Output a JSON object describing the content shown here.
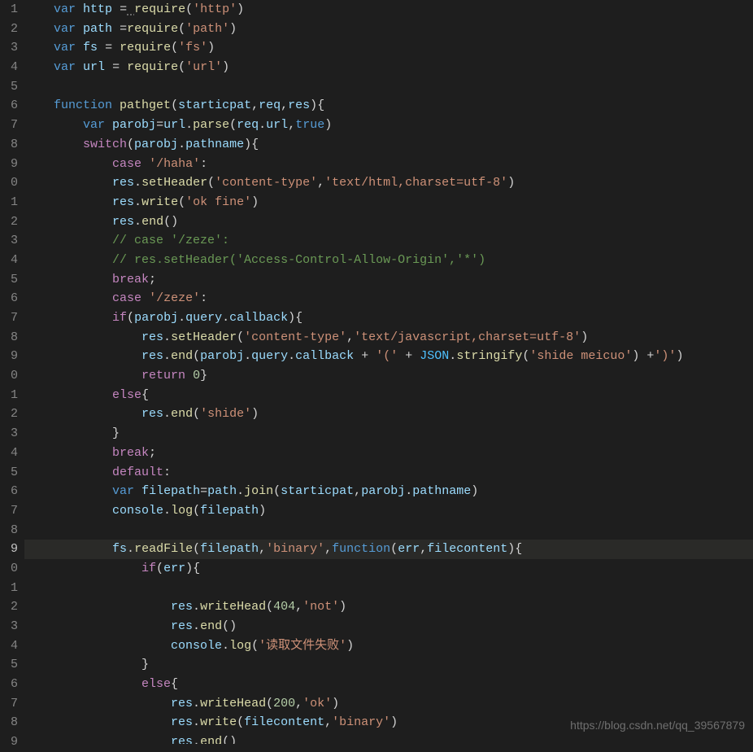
{
  "editor": {
    "highlighted_line_index": 28,
    "gutter": [
      "1",
      "2",
      "3",
      "4",
      "5",
      "6",
      "7",
      "8",
      "9",
      "0",
      "1",
      "2",
      "3",
      "4",
      "5",
      "6",
      "7",
      "8",
      "9",
      "0",
      "1",
      "2",
      "3",
      "4",
      "5",
      "6",
      "7",
      "8",
      "9",
      "0",
      "1",
      "2",
      "3",
      "4",
      "5",
      "6",
      "7",
      "8",
      "9"
    ],
    "lines": [
      {
        "indent": 1,
        "tokens": [
          [
            "keyword",
            "var"
          ],
          [
            "plain",
            " "
          ],
          [
            "var",
            "http"
          ],
          [
            "plain",
            " "
          ],
          [
            "punct",
            "="
          ],
          [
            "plain",
            " "
          ],
          [
            "func",
            "require"
          ],
          [
            "punct",
            "("
          ],
          [
            "string",
            "'http'"
          ],
          [
            "punct",
            ")"
          ]
        ],
        "squiggle": 5
      },
      {
        "indent": 1,
        "tokens": [
          [
            "keyword",
            "var"
          ],
          [
            "plain",
            " "
          ],
          [
            "var",
            "path"
          ],
          [
            "plain",
            " "
          ],
          [
            "punct",
            "="
          ],
          [
            "func",
            "require"
          ],
          [
            "punct",
            "("
          ],
          [
            "string",
            "'path'"
          ],
          [
            "punct",
            ")"
          ]
        ]
      },
      {
        "indent": 1,
        "tokens": [
          [
            "keyword",
            "var"
          ],
          [
            "plain",
            " "
          ],
          [
            "var",
            "fs"
          ],
          [
            "plain",
            " "
          ],
          [
            "punct",
            "="
          ],
          [
            "plain",
            " "
          ],
          [
            "func",
            "require"
          ],
          [
            "punct",
            "("
          ],
          [
            "string",
            "'fs'"
          ],
          [
            "punct",
            ")"
          ]
        ]
      },
      {
        "indent": 1,
        "tokens": [
          [
            "keyword",
            "var"
          ],
          [
            "plain",
            " "
          ],
          [
            "var",
            "url"
          ],
          [
            "plain",
            " "
          ],
          [
            "punct",
            "="
          ],
          [
            "plain",
            " "
          ],
          [
            "func",
            "require"
          ],
          [
            "punct",
            "("
          ],
          [
            "string",
            "'url'"
          ],
          [
            "punct",
            ")"
          ]
        ]
      },
      {
        "indent": 0,
        "tokens": []
      },
      {
        "indent": 1,
        "tokens": [
          [
            "keyword",
            "function"
          ],
          [
            "plain",
            " "
          ],
          [
            "func",
            "pathget"
          ],
          [
            "punct",
            "("
          ],
          [
            "param",
            "starticpat"
          ],
          [
            "punct",
            ","
          ],
          [
            "param",
            "req"
          ],
          [
            "punct",
            ","
          ],
          [
            "param",
            "res"
          ],
          [
            "punct",
            ")"
          ],
          [
            "punct",
            "{"
          ]
        ]
      },
      {
        "indent": 2,
        "tokens": [
          [
            "keyword",
            "var"
          ],
          [
            "plain",
            " "
          ],
          [
            "var",
            "parobj"
          ],
          [
            "punct",
            "="
          ],
          [
            "var",
            "url"
          ],
          [
            "punct",
            "."
          ],
          [
            "func",
            "parse"
          ],
          [
            "punct",
            "("
          ],
          [
            "var",
            "req"
          ],
          [
            "punct",
            "."
          ],
          [
            "var",
            "url"
          ],
          [
            "punct",
            ","
          ],
          [
            "keyword",
            "true"
          ],
          [
            "punct",
            ")"
          ]
        ]
      },
      {
        "indent": 2,
        "tokens": [
          [
            "control",
            "switch"
          ],
          [
            "punct",
            "("
          ],
          [
            "var",
            "parobj"
          ],
          [
            "punct",
            "."
          ],
          [
            "var",
            "pathname"
          ],
          [
            "punct",
            ")"
          ],
          [
            "punct",
            "{"
          ]
        ]
      },
      {
        "indent": 3,
        "tokens": [
          [
            "control",
            "case"
          ],
          [
            "plain",
            " "
          ],
          [
            "string",
            "'/haha'"
          ],
          [
            "punct",
            ":"
          ]
        ]
      },
      {
        "indent": 3,
        "tokens": [
          [
            "var",
            "res"
          ],
          [
            "punct",
            "."
          ],
          [
            "func",
            "setHeader"
          ],
          [
            "punct",
            "("
          ],
          [
            "string",
            "'content-type'"
          ],
          [
            "punct",
            ","
          ],
          [
            "string",
            "'text/html,charset=utf-8'"
          ],
          [
            "punct",
            ")"
          ]
        ]
      },
      {
        "indent": 3,
        "tokens": [
          [
            "var",
            "res"
          ],
          [
            "punct",
            "."
          ],
          [
            "func",
            "write"
          ],
          [
            "punct",
            "("
          ],
          [
            "string",
            "'ok fine'"
          ],
          [
            "punct",
            ")"
          ]
        ]
      },
      {
        "indent": 3,
        "tokens": [
          [
            "var",
            "res"
          ],
          [
            "punct",
            "."
          ],
          [
            "func",
            "end"
          ],
          [
            "punct",
            "()"
          ]
        ]
      },
      {
        "indent": 3,
        "tokens": [
          [
            "comment",
            "// case '/zeze':"
          ]
        ]
      },
      {
        "indent": 3,
        "tokens": [
          [
            "comment",
            "// res.setHeader('Access-Control-Allow-Origin','*')"
          ]
        ]
      },
      {
        "indent": 3,
        "tokens": [
          [
            "control",
            "break"
          ],
          [
            "punct",
            ";"
          ]
        ]
      },
      {
        "indent": 3,
        "tokens": [
          [
            "control",
            "case"
          ],
          [
            "plain",
            " "
          ],
          [
            "string",
            "'/zeze'"
          ],
          [
            "punct",
            ":"
          ]
        ]
      },
      {
        "indent": 3,
        "tokens": [
          [
            "control",
            "if"
          ],
          [
            "punct",
            "("
          ],
          [
            "var",
            "parobj"
          ],
          [
            "punct",
            "."
          ],
          [
            "var",
            "query"
          ],
          [
            "punct",
            "."
          ],
          [
            "var",
            "callback"
          ],
          [
            "punct",
            ")"
          ],
          [
            "punct",
            "{"
          ]
        ]
      },
      {
        "indent": 4,
        "tokens": [
          [
            "var",
            "res"
          ],
          [
            "punct",
            "."
          ],
          [
            "func",
            "setHeader"
          ],
          [
            "punct",
            "("
          ],
          [
            "string",
            "'content-type'"
          ],
          [
            "punct",
            ","
          ],
          [
            "string",
            "'text/javascript,charset=utf-8'"
          ],
          [
            "punct",
            ")"
          ]
        ]
      },
      {
        "indent": 4,
        "tokens": [
          [
            "var",
            "res"
          ],
          [
            "punct",
            "."
          ],
          [
            "func",
            "end"
          ],
          [
            "punct",
            "("
          ],
          [
            "var",
            "parobj"
          ],
          [
            "punct",
            "."
          ],
          [
            "var",
            "query"
          ],
          [
            "punct",
            "."
          ],
          [
            "var",
            "callback"
          ],
          [
            "plain",
            " "
          ],
          [
            "punct",
            "+"
          ],
          [
            "plain",
            " "
          ],
          [
            "string",
            "'('"
          ],
          [
            "plain",
            " "
          ],
          [
            "punct",
            "+"
          ],
          [
            "plain",
            " "
          ],
          [
            "const",
            "JSON"
          ],
          [
            "punct",
            "."
          ],
          [
            "func",
            "stringify"
          ],
          [
            "punct",
            "("
          ],
          [
            "string",
            "'shide meicuo'"
          ],
          [
            "punct",
            ")"
          ],
          [
            "plain",
            " "
          ],
          [
            "punct",
            "+"
          ],
          [
            "string",
            "')'"
          ],
          [
            "punct",
            ")"
          ]
        ]
      },
      {
        "indent": 4,
        "tokens": [
          [
            "control",
            "return"
          ],
          [
            "plain",
            " "
          ],
          [
            "number",
            "0"
          ],
          [
            "punct",
            "}"
          ]
        ]
      },
      {
        "indent": 3,
        "tokens": [
          [
            "control",
            "else"
          ],
          [
            "punct",
            "{"
          ]
        ]
      },
      {
        "indent": 4,
        "tokens": [
          [
            "var",
            "res"
          ],
          [
            "punct",
            "."
          ],
          [
            "func",
            "end"
          ],
          [
            "punct",
            "("
          ],
          [
            "string",
            "'shide'"
          ],
          [
            "punct",
            ")"
          ]
        ]
      },
      {
        "indent": 3,
        "tokens": [
          [
            "punct",
            "}"
          ]
        ]
      },
      {
        "indent": 3,
        "tokens": [
          [
            "control",
            "break"
          ],
          [
            "punct",
            ";"
          ]
        ]
      },
      {
        "indent": 3,
        "tokens": [
          [
            "control",
            "default"
          ],
          [
            "punct",
            ":"
          ]
        ]
      },
      {
        "indent": 3,
        "tokens": [
          [
            "keyword",
            "var"
          ],
          [
            "plain",
            " "
          ],
          [
            "var",
            "filepath"
          ],
          [
            "punct",
            "="
          ],
          [
            "var",
            "path"
          ],
          [
            "punct",
            "."
          ],
          [
            "func",
            "join"
          ],
          [
            "punct",
            "("
          ],
          [
            "var",
            "starticpat"
          ],
          [
            "punct",
            ","
          ],
          [
            "var",
            "parobj"
          ],
          [
            "punct",
            "."
          ],
          [
            "var",
            "pathname"
          ],
          [
            "punct",
            ")"
          ]
        ]
      },
      {
        "indent": 3,
        "tokens": [
          [
            "var",
            "console"
          ],
          [
            "punct",
            "."
          ],
          [
            "func",
            "log"
          ],
          [
            "punct",
            "("
          ],
          [
            "var",
            "filepath"
          ],
          [
            "punct",
            ")"
          ]
        ]
      },
      {
        "indent": 0,
        "tokens": []
      },
      {
        "indent": 3,
        "tokens": [
          [
            "var",
            "fs"
          ],
          [
            "punct",
            "."
          ],
          [
            "func",
            "readFile"
          ],
          [
            "punct",
            "("
          ],
          [
            "var",
            "filepath"
          ],
          [
            "punct",
            ","
          ],
          [
            "string",
            "'binary'"
          ],
          [
            "punct",
            ","
          ],
          [
            "keyword",
            "function"
          ],
          [
            "punct",
            "("
          ],
          [
            "param",
            "err"
          ],
          [
            "punct",
            ","
          ],
          [
            "param",
            "filecontent"
          ],
          [
            "punct",
            ")"
          ],
          [
            "punct",
            "{"
          ]
        ]
      },
      {
        "indent": 4,
        "tokens": [
          [
            "control",
            "if"
          ],
          [
            "punct",
            "("
          ],
          [
            "var",
            "err"
          ],
          [
            "punct",
            ")"
          ],
          [
            "punct",
            "{"
          ]
        ]
      },
      {
        "indent": 0,
        "tokens": []
      },
      {
        "indent": 5,
        "tokens": [
          [
            "var",
            "res"
          ],
          [
            "punct",
            "."
          ],
          [
            "func",
            "writeHead"
          ],
          [
            "punct",
            "("
          ],
          [
            "number",
            "404"
          ],
          [
            "punct",
            ","
          ],
          [
            "string",
            "'not'"
          ],
          [
            "punct",
            ")"
          ]
        ]
      },
      {
        "indent": 5,
        "tokens": [
          [
            "var",
            "res"
          ],
          [
            "punct",
            "."
          ],
          [
            "func",
            "end"
          ],
          [
            "punct",
            "()"
          ]
        ]
      },
      {
        "indent": 5,
        "tokens": [
          [
            "var",
            "console"
          ],
          [
            "punct",
            "."
          ],
          [
            "func",
            "log"
          ],
          [
            "punct",
            "("
          ],
          [
            "string",
            "'读取文件失败'"
          ],
          [
            "punct",
            ")"
          ]
        ]
      },
      {
        "indent": 4,
        "tokens": [
          [
            "punct",
            "}"
          ]
        ]
      },
      {
        "indent": 4,
        "tokens": [
          [
            "control",
            "else"
          ],
          [
            "punct",
            "{"
          ]
        ]
      },
      {
        "indent": 5,
        "tokens": [
          [
            "var",
            "res"
          ],
          [
            "punct",
            "."
          ],
          [
            "func",
            "writeHead"
          ],
          [
            "punct",
            "("
          ],
          [
            "number",
            "200"
          ],
          [
            "punct",
            ","
          ],
          [
            "string",
            "'ok'"
          ],
          [
            "punct",
            ")"
          ]
        ]
      },
      {
        "indent": 5,
        "tokens": [
          [
            "var",
            "res"
          ],
          [
            "punct",
            "."
          ],
          [
            "func",
            "write"
          ],
          [
            "punct",
            "("
          ],
          [
            "var",
            "filecontent"
          ],
          [
            "punct",
            ","
          ],
          [
            "string",
            "'binary'"
          ],
          [
            "punct",
            ")"
          ]
        ]
      },
      {
        "indent": 5,
        "tokens": [
          [
            "var",
            "res"
          ],
          [
            "punct",
            "."
          ],
          [
            "func",
            "end"
          ],
          [
            "punct",
            "()"
          ]
        ]
      }
    ]
  },
  "watermark": "https://blog.csdn.net/qq_39567879"
}
